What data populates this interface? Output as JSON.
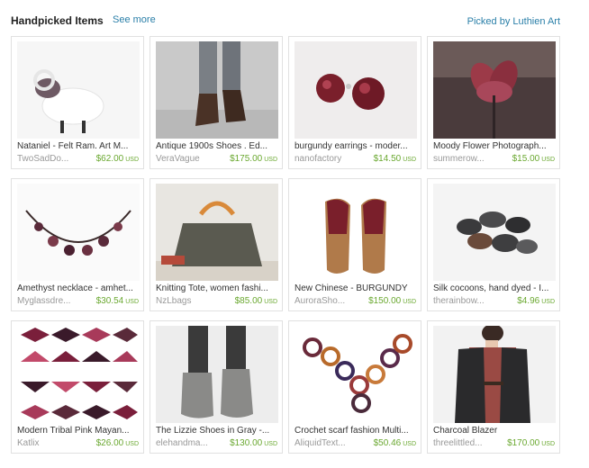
{
  "header": {
    "title": "Handpicked Items",
    "see_more": "See more",
    "picked_by": "Picked by Luthien Art"
  },
  "items": [
    {
      "name": "Nataniel - Felt Ram. Art M...",
      "shop": "TwoSadDo...",
      "price": "$62.00",
      "currency": "USD",
      "icon": "felt-ram-image"
    },
    {
      "name": "Antique 1900s Shoes . Ed...",
      "shop": "VeraVague",
      "price": "$175.00",
      "currency": "USD",
      "icon": "antique-shoes-image"
    },
    {
      "name": "burgundy earrings - moder...",
      "shop": "nanofactory",
      "price": "$14.50",
      "currency": "USD",
      "icon": "burgundy-earrings-image"
    },
    {
      "name": "Moody Flower Photograph...",
      "shop": "summerow...",
      "price": "$15.00",
      "currency": "USD",
      "icon": "flower-photo-image"
    },
    {
      "name": "Amethyst necklace - amhet...",
      "shop": "Myglassdre...",
      "price": "$30.54",
      "currency": "USD",
      "icon": "amethyst-necklace-image"
    },
    {
      "name": "Knitting Tote, women fashi...",
      "shop": "NzLbags",
      "price": "$85.00",
      "currency": "USD",
      "icon": "knitting-tote-image"
    },
    {
      "name": "New Chinese - BURGUNDY",
      "shop": "AuroraSho...",
      "price": "$150.00",
      "currency": "USD",
      "icon": "burgundy-sandals-image"
    },
    {
      "name": "Silk cocoons, hand dyed - I...",
      "shop": "therainbow...",
      "price": "$4.96",
      "currency": "USD",
      "icon": "silk-cocoons-image"
    },
    {
      "name": "Modern Tribal Pink Mayan...",
      "shop": "Katlix",
      "price": "$26.00",
      "currency": "USD",
      "icon": "tribal-pattern-image"
    },
    {
      "name": "The Lizzie Shoes in Gray -...",
      "shop": "elehandma...",
      "price": "$130.00",
      "currency": "USD",
      "icon": "gray-shoes-image"
    },
    {
      "name": "Crochet scarf fashion Multi...",
      "shop": "AliquidText...",
      "price": "$50.46",
      "currency": "USD",
      "icon": "crochet-scarf-image"
    },
    {
      "name": "Charcoal Blazer",
      "shop": "threelittled...",
      "price": "$170.00",
      "currency": "USD",
      "icon": "charcoal-blazer-image"
    }
  ]
}
